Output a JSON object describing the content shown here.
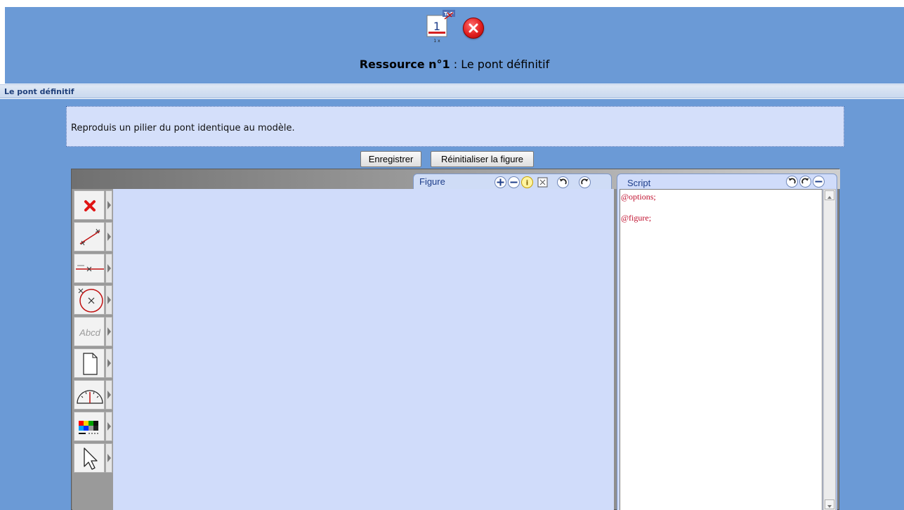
{
  "header": {
    "resource_icon": {
      "number": "1",
      "top_label": "TeP",
      "bottom_label": "1 x"
    },
    "close_icon": "close-icon",
    "title_prefix": "Ressource n°1",
    "title_sep": " : ",
    "title_name": "Le pont définitif"
  },
  "section": {
    "title": "Le pont définitif"
  },
  "instruction": "Reproduis un pilier du pont identique au modèle.",
  "buttons": {
    "save": "Enregistrer",
    "reset": "Réinitialiser la figure"
  },
  "toolbar": {
    "tools": [
      {
        "name": "delete",
        "icon": "red-cross-icon"
      },
      {
        "name": "segment",
        "icon": "segment-icon"
      },
      {
        "name": "line",
        "icon": "line-icon"
      },
      {
        "name": "circle",
        "icon": "circle-icon"
      },
      {
        "name": "text",
        "icon": "text-icon",
        "label": "Abcd"
      },
      {
        "name": "page",
        "icon": "page-icon"
      },
      {
        "name": "measure",
        "icon": "protractor-icon"
      },
      {
        "name": "colors",
        "icon": "palette-icon"
      },
      {
        "name": "select",
        "icon": "cursor-arrow-icon"
      }
    ]
  },
  "figure": {
    "tab_label": "Figure",
    "controls": [
      "zoom-in-icon",
      "zoom-out-icon",
      "info-icon",
      "fit-icon",
      "undo-icon",
      "redo-icon"
    ]
  },
  "script": {
    "tab_label": "Script",
    "controls": [
      "undo-icon",
      "redo-icon",
      "minimize-icon"
    ],
    "lines": [
      "@options;",
      "",
      "@figure;"
    ]
  },
  "colors": {
    "background": "#6b9ad6",
    "canvas": "#d0dcfa",
    "accent": "#1e3e8a",
    "script_text": "#c0102e"
  }
}
